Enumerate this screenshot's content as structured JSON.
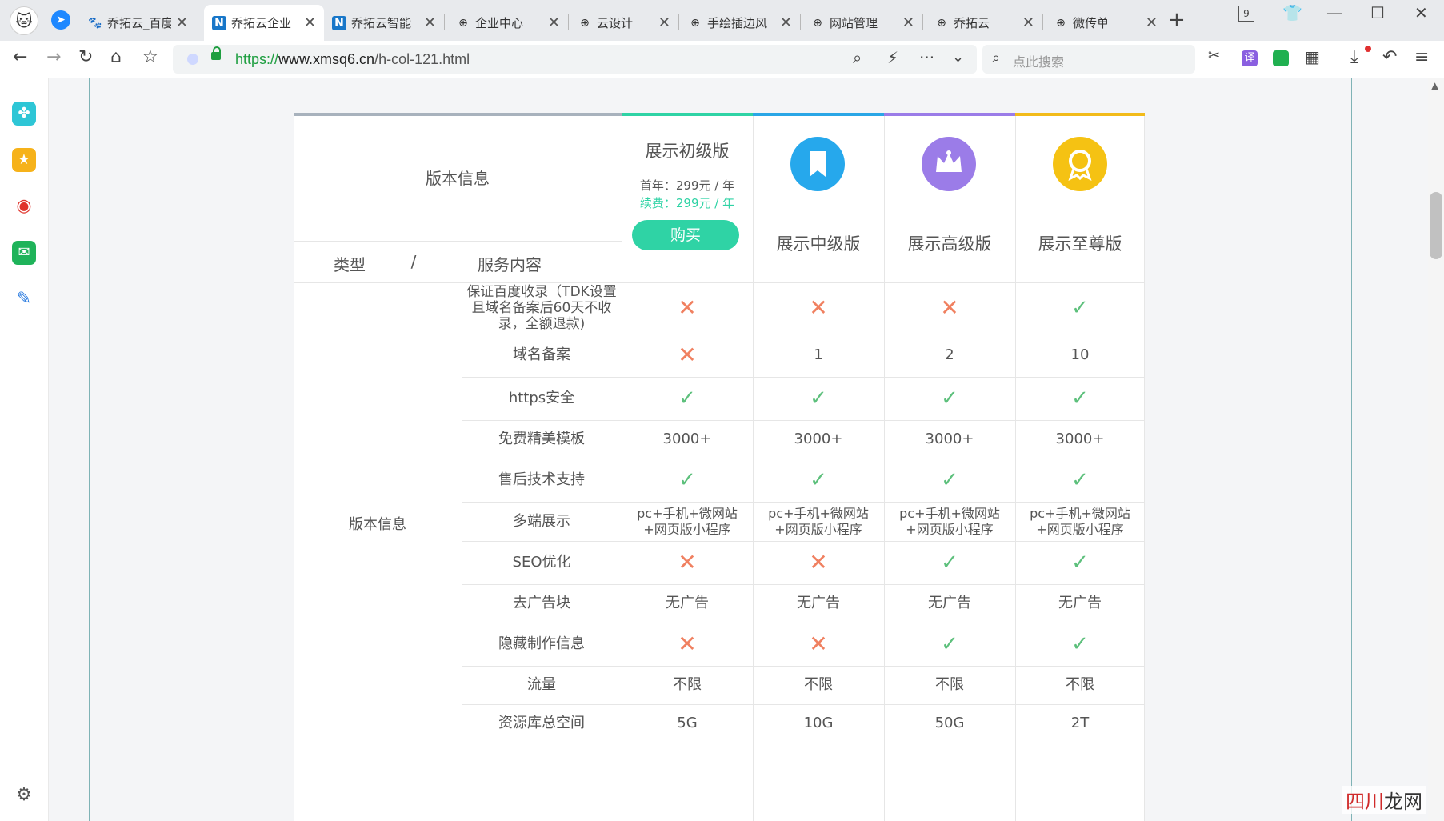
{
  "browser": {
    "tabs": [
      {
        "title": "乔拓云_百度",
        "icon": "paw-icon",
        "active": false
      },
      {
        "title": "乔拓云企业",
        "icon": "n-logo-icon",
        "active": true
      },
      {
        "title": "乔拓云智能",
        "icon": "n-logo-icon",
        "active": false
      },
      {
        "title": "企业中心",
        "icon": "globe-icon",
        "active": false
      },
      {
        "title": "云设计",
        "icon": "globe-icon",
        "active": false
      },
      {
        "title": "手绘插边风",
        "icon": "globe-icon",
        "active": false
      },
      {
        "title": "网站管理",
        "icon": "globe-icon",
        "active": false
      },
      {
        "title": "乔拓云",
        "icon": "globe-icon",
        "active": false
      },
      {
        "title": "微传单",
        "icon": "globe-icon",
        "active": false
      }
    ],
    "tab_count": "9",
    "url_scheme": "https://",
    "url_host": "www.xmsq6.cn",
    "url_path": "/h-col-121.html",
    "search_placeholder": "点此搜索",
    "translate_label": "译"
  },
  "table": {
    "header_title": "版本信息",
    "type_label": "类型",
    "slash": "/",
    "service_label": "服务内容",
    "plans": [
      {
        "name": "展示初级版",
        "accent": "#2fd3a5",
        "first_year": "首年：299元 / 年",
        "renewal": "续费：299元 / 年",
        "buy_label": "购买"
      },
      {
        "name": "展示中级版",
        "accent": "#2aa6e6",
        "icon": "bookmark-icon"
      },
      {
        "name": "展示高级版",
        "accent": "#9b7ce8",
        "icon": "crown-icon"
      },
      {
        "name": "展示至尊版",
        "accent": "#f2bb1a",
        "icon": "award-icon"
      }
    ],
    "group_label": "版本信息",
    "rows": [
      {
        "feature": "保证百度收录（TDK设置且域名备案后60天不收录，全额退款)",
        "values": [
          "x",
          "x",
          "x",
          "check"
        ]
      },
      {
        "feature": "域名备案",
        "values": [
          "x",
          "1",
          "2",
          "10"
        ]
      },
      {
        "feature": "https安全",
        "values": [
          "check",
          "check",
          "check",
          "check"
        ]
      },
      {
        "feature": "免费精美模板",
        "values": [
          "3000+",
          "3000+",
          "3000+",
          "3000+"
        ]
      },
      {
        "feature": "售后技术支持",
        "values": [
          "check",
          "check",
          "check",
          "check"
        ]
      },
      {
        "feature": "多端展示",
        "values": [
          "pc+手机+微网站+网页版小程序",
          "pc+手机+微网站+网页版小程序",
          "pc+手机+微网站+网页版小程序",
          "pc+手机+微网站+网页版小程序"
        ]
      },
      {
        "feature": "SEO优化",
        "values": [
          "x",
          "x",
          "check",
          "check"
        ]
      },
      {
        "feature": "去广告块",
        "values": [
          "无广告",
          "无广告",
          "无广告",
          "无广告"
        ]
      },
      {
        "feature": "隐藏制作信息",
        "values": [
          "x",
          "x",
          "check",
          "check"
        ]
      },
      {
        "feature": "流量",
        "values": [
          "不限",
          "不限",
          "不限",
          "不限"
        ]
      },
      {
        "feature": "资源库总空间",
        "values": [
          "5G",
          "10G",
          "50G",
          "2T"
        ]
      }
    ]
  },
  "watermark": {
    "part1": "四川",
    "part2": "龙网"
  }
}
